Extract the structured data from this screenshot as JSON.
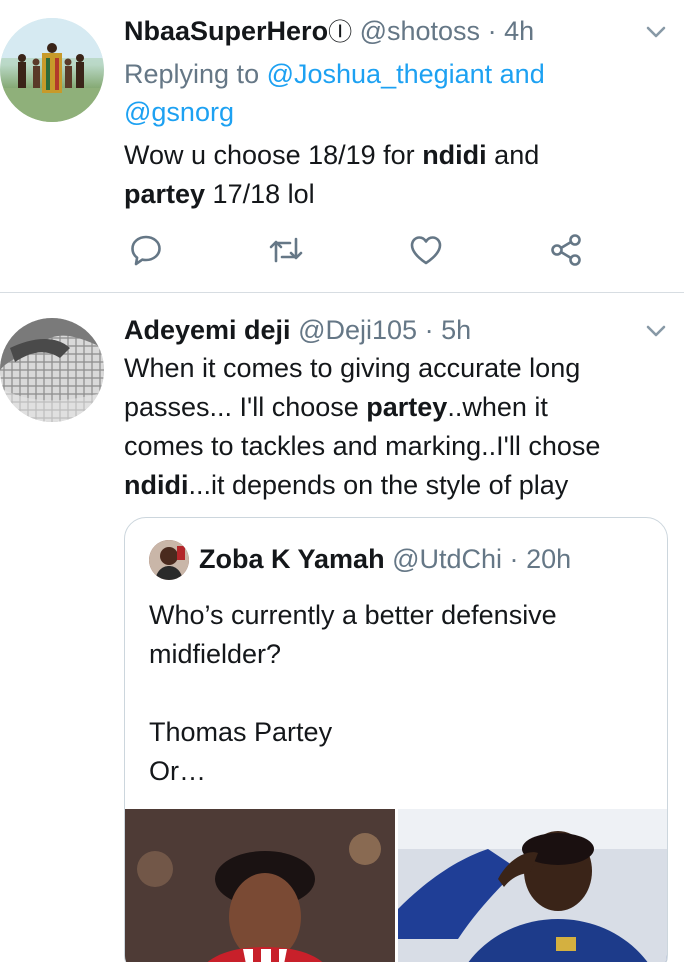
{
  "tweets": [
    {
      "avatar_icon": "user-avatar-icon",
      "name": "NbaaSuperHero",
      "verified_glyph": "Ⓘ",
      "handle": "@shotoss",
      "separator": "·",
      "time": "4h",
      "reply_prefix": "Replying to ",
      "reply_link_1": "@Joshua_thegiant and",
      "reply_link_2": "@gsnorg",
      "text": {
        "part1": "Wow u choose 18/19 for ",
        "bold1": "ndidi",
        "part2": " and",
        "bold2": "partey",
        "part3": " 17/18  lol"
      }
    },
    {
      "avatar_icon": "user-avatar-icon",
      "name": "Adeyemi deji",
      "handle": "@Deji105",
      "separator": "·",
      "time": "5h",
      "text": {
        "line1": "When it comes to giving accurate long",
        "line2_pre": "passes... I'll choose ",
        "line2_bold": "partey",
        "line2_post": "..when it",
        "line3": "comes to tackles and marking..I'll chose",
        "line4_bold": "ndidi",
        "line4_post": "...it depends on the style of play"
      },
      "quote": {
        "name": "Zoba K Yamah",
        "handle": "@UtdChi",
        "separator": "·",
        "time": "20h",
        "line1": "Who’s currently a better defensive",
        "line2": "midfielder?",
        "line3": "Thomas Partey",
        "line4": "Or…"
      }
    }
  ],
  "icons": [
    "reply-icon",
    "retweet-icon",
    "like-icon",
    "share-icon",
    "chevron-down-icon"
  ],
  "colors": {
    "link": "#1da1f2",
    "secondary_text": "#657786",
    "divider": "#d7dde2"
  }
}
